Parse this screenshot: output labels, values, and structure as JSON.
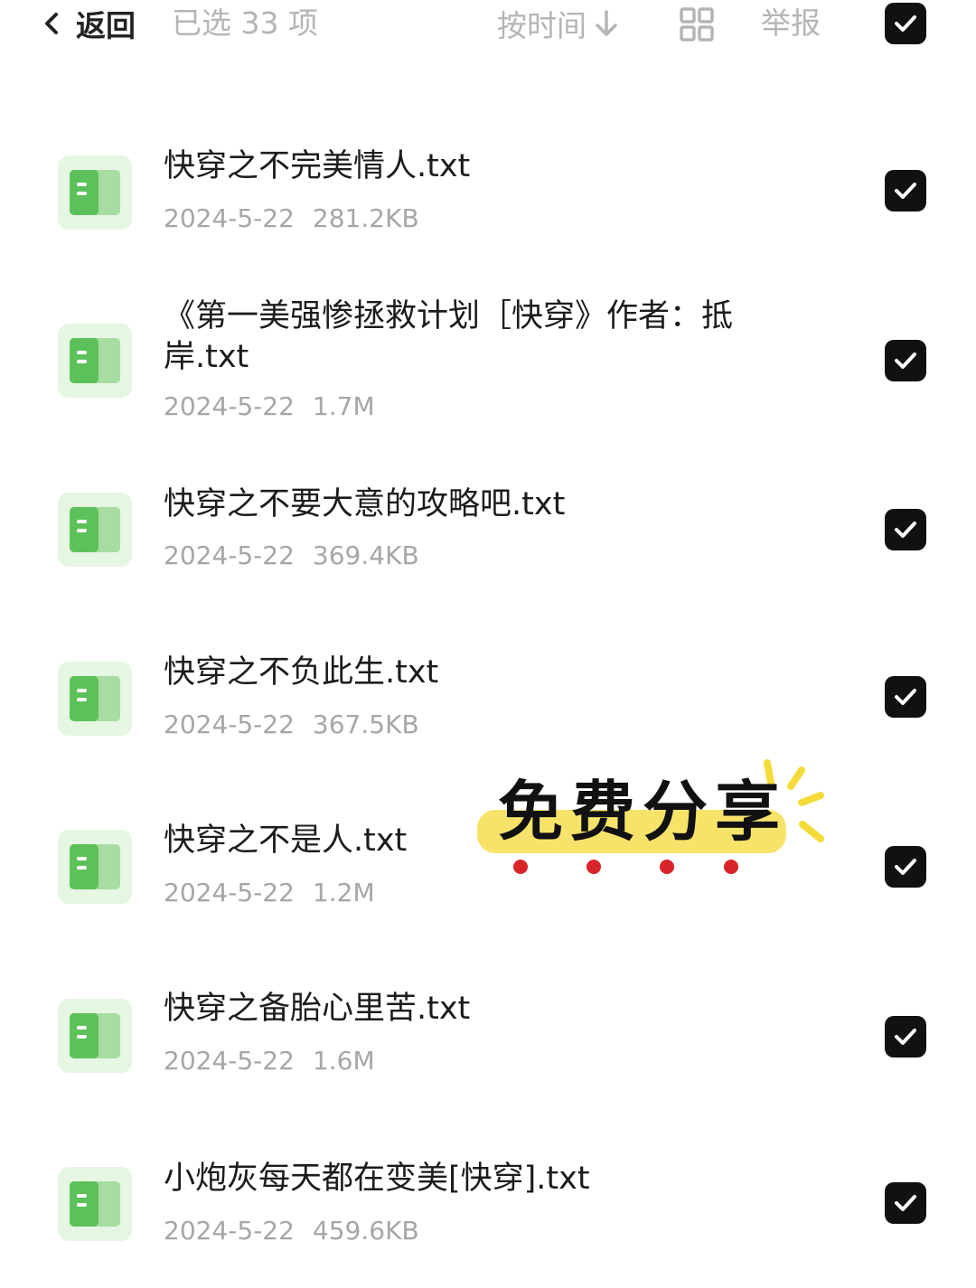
{
  "header": {
    "back_label": "返回",
    "selected_label": "已选 33 项",
    "sort_label": "按时间",
    "report_label": "举报"
  },
  "files": [
    {
      "name": "快穿之不完美情人.txt",
      "date": "2024-5-22",
      "size": "281.2KB",
      "checked": true
    },
    {
      "name": "《第一美强惨拯救计划［快穿》作者：抵岸.txt",
      "date": "2024-5-22",
      "size": "1.7M",
      "checked": true
    },
    {
      "name": "快穿之不要大意的攻略吧.txt",
      "date": "2024-5-22",
      "size": "369.4KB",
      "checked": true
    },
    {
      "name": "快穿之不负此生.txt",
      "date": "2024-5-22",
      "size": "367.5KB",
      "checked": true
    },
    {
      "name": "快穿之不是人.txt",
      "date": "2024-5-22",
      "size": "1.2M",
      "checked": true
    },
    {
      "name": "快穿之备胎心里苦.txt",
      "date": "2024-5-22",
      "size": "1.6M",
      "checked": true
    },
    {
      "name": "小炮灰每天都在变美[快穿].txt",
      "date": "2024-5-22",
      "size": "459.6KB",
      "checked": true
    }
  ],
  "sticker": {
    "text": "免费分享"
  },
  "colors": {
    "check_fill": "#111111",
    "icon_bg": "#e5f6e2",
    "icon_book": "#5cc15a",
    "sticker_highlight": "#f8e36a",
    "sticker_dots": "#d8252a",
    "muted_text": "#b5b5b5"
  },
  "icons": {
    "back": "chevron-left-icon",
    "sort": "arrow-down-icon",
    "grid": "grid-view-icon",
    "check": "checkmark-icon",
    "file": "book-icon"
  }
}
